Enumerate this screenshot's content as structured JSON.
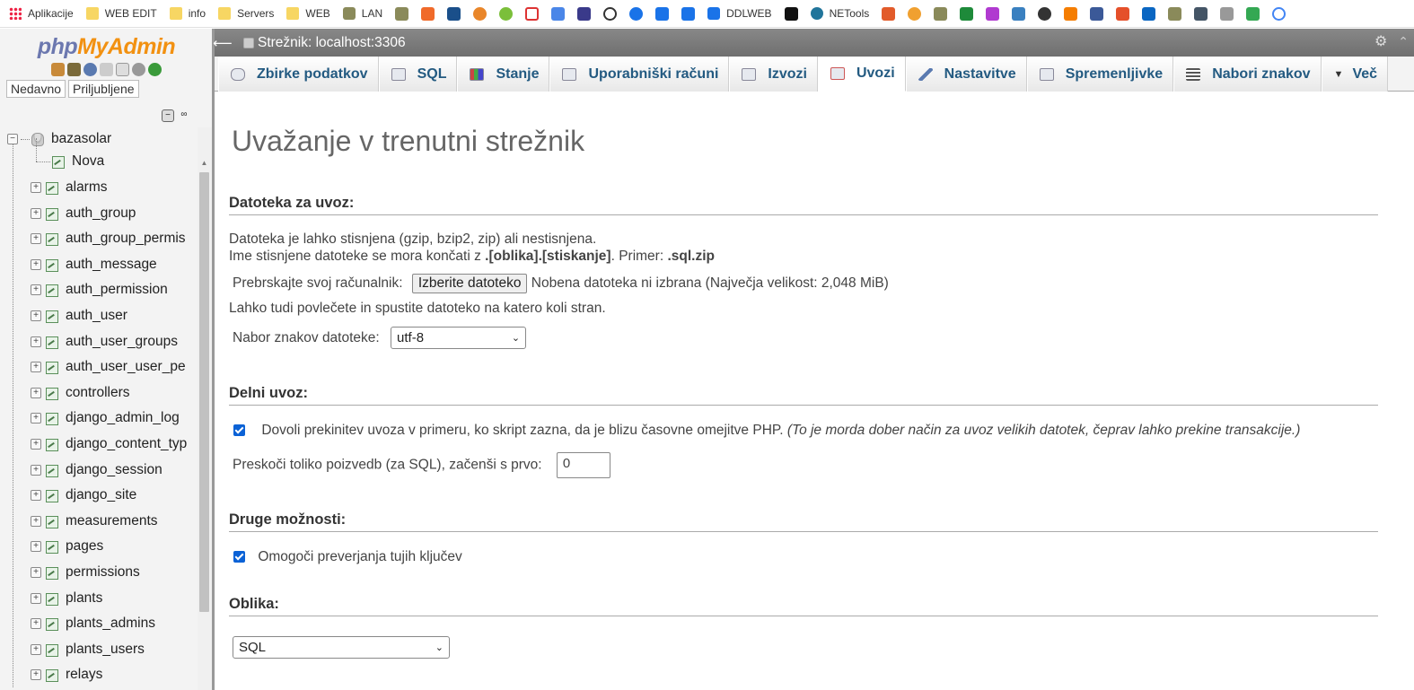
{
  "bookmarks": [
    {
      "label": "Aplikacije",
      "kind": "apps"
    },
    {
      "label": "WEB EDIT",
      "kind": "folder"
    },
    {
      "label": "info",
      "kind": "folder"
    },
    {
      "label": "Servers",
      "kind": "folder"
    },
    {
      "label": "WEB",
      "kind": "folder"
    },
    {
      "label": "LAN",
      "kind": "icon"
    },
    {
      "label": "DDLWEB",
      "kind": "icon"
    },
    {
      "label": "NETools",
      "kind": "icon"
    }
  ],
  "nav": {
    "logo_php": "php",
    "logo_my": "My",
    "logo_admin": "Admin",
    "recent": "Nedavno",
    "favorites": "Priljubljene",
    "database": "bazasolar",
    "new_item": "Nova",
    "tables": [
      "alarms",
      "auth_group",
      "auth_group_permis",
      "auth_message",
      "auth_permission",
      "auth_user",
      "auth_user_groups",
      "auth_user_user_pe",
      "controllers",
      "django_admin_log",
      "django_content_typ",
      "django_session",
      "django_site",
      "measurements",
      "pages",
      "permissions",
      "plants",
      "plants_admins",
      "plants_users",
      "relays"
    ]
  },
  "serverbar": {
    "label": "Strežnik: localhost:3306"
  },
  "tabs": [
    {
      "label": "Zbirke podatkov",
      "active": false
    },
    {
      "label": "SQL",
      "active": false
    },
    {
      "label": "Stanje",
      "active": false
    },
    {
      "label": "Uporabniški računi",
      "active": false
    },
    {
      "label": "Izvozi",
      "active": false
    },
    {
      "label": "Uvozi",
      "active": true
    },
    {
      "label": "Nastavitve",
      "active": false
    },
    {
      "label": "Spremenljivke",
      "active": false
    },
    {
      "label": "Nabori znakov",
      "active": false
    },
    {
      "label": "Več",
      "active": false
    }
  ],
  "main": {
    "title": "Uvažanje v trenutni strežnik",
    "file_section": "Datoteka za uvoz:",
    "file_note1": "Datoteka je lahko stisnjena (gzip, bzip2, zip) ali nestisnjena.",
    "file_note2_a": "Ime stisnjene datoteke se mora končati z ",
    "file_note2_b": ".[oblika].[stiskanje]",
    "file_note2_c": ". Primer: ",
    "file_note2_d": ".sql.zip",
    "browse_label": "Prebrskajte svoj računalnik:",
    "choose_button": "Izberite datoteko",
    "no_file": "Nobena datoteka ni izbrana",
    "max_size": "(Največja velikost: 2,048 MiB)",
    "drag_note": "Lahko tudi povlečete in spustite datoteko na katero koli stran.",
    "charset_label": "Nabor znakov datoteke:",
    "charset_value": "utf-8",
    "partial_section": "Delni uvoz:",
    "allow_interrupt": "Dovoli prekinitev uvoza v primeru, ko skript zazna, da je blizu časovne omejitve PHP.",
    "allow_interrupt_note": "(To je morda dober način za uvoz velikih datotek, čeprav lahko prekine transakcije.)",
    "skip_label": "Preskoči toliko poizvedb (za SQL), začenši s prvo:",
    "skip_value": "0",
    "other_section": "Druge možnosti:",
    "fk_checks": "Omogoči preverjanja tujih ključev",
    "format_section": "Oblika:",
    "format_value": "SQL"
  }
}
